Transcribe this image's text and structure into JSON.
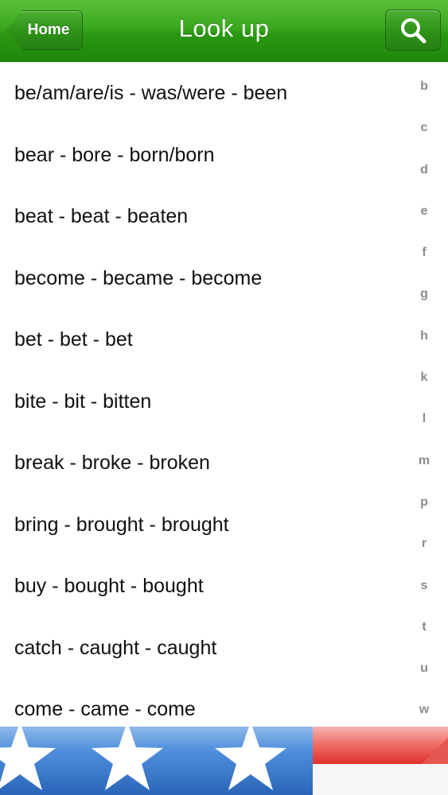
{
  "navbar": {
    "back_label": "Home",
    "title": "Look up",
    "search_icon": "search-icon"
  },
  "verbs": [
    "be/am/are/is - was/were - been",
    "bear - bore - born/born",
    "beat - beat - beaten",
    "become - became - become",
    "bet - bet - bet",
    "bite - bit - bitten",
    "break - broke - broken",
    "bring - brought - brought",
    "buy - bought - bought",
    "catch - caught - caught",
    "come - came - come"
  ],
  "index_letters": [
    "b",
    "c",
    "d",
    "e",
    "f",
    "g",
    "h",
    "k",
    "l",
    "m",
    "p",
    "r",
    "s",
    "t",
    "u",
    "w"
  ],
  "colors": {
    "nav_green": "#2b9712",
    "flag_blue": "#3a78c8",
    "flag_red": "#e0302c"
  }
}
